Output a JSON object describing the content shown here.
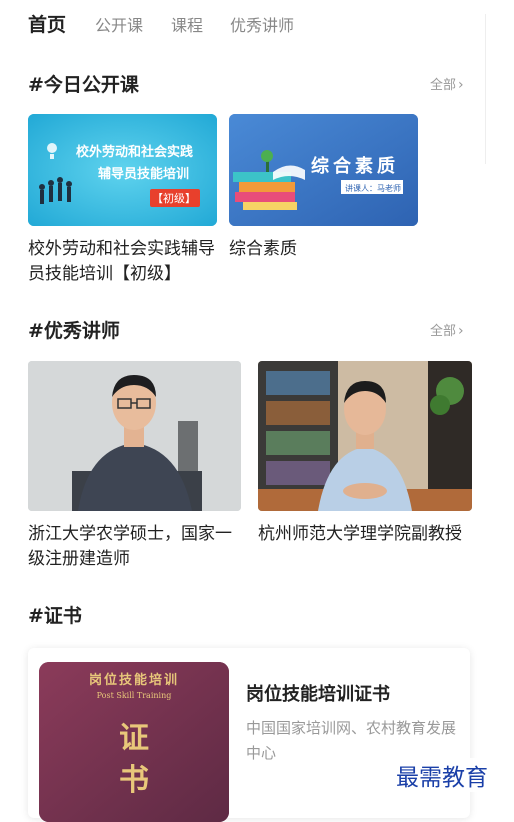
{
  "tabs": [
    {
      "label": "首页"
    },
    {
      "label": "公开课"
    },
    {
      "label": "课程"
    },
    {
      "label": "优秀讲师"
    }
  ],
  "courses": {
    "title": "#今日公开课",
    "more": "全部",
    "items": [
      {
        "title": "校外劳动和社会实践辅导员技能培训【初级】",
        "thumb_line1": "校外劳动和社会实践",
        "thumb_line2": "辅导员技能培训",
        "thumb_badge": "【初级】"
      },
      {
        "title": "综合素质",
        "thumb_title": "综合素质",
        "thumb_lecturer": "讲课人：马老师"
      }
    ]
  },
  "teachers": {
    "title": "#优秀讲师",
    "more": "全部",
    "items": [
      {
        "desc": "浙江大学农学硕士，国家一级注册建造师"
      },
      {
        "desc": "杭州师范大学理学院副教授"
      }
    ]
  },
  "certificates": {
    "title": "#证书",
    "item": {
      "cover_title": "岗位技能培训",
      "cover_subtitle": "Post Skill Training",
      "cover_char1": "证",
      "cover_char2": "书",
      "name": "岗位技能培训证书",
      "issuer": "中国国家培训网、农村教育发展中心"
    }
  },
  "watermark": "最需教育"
}
